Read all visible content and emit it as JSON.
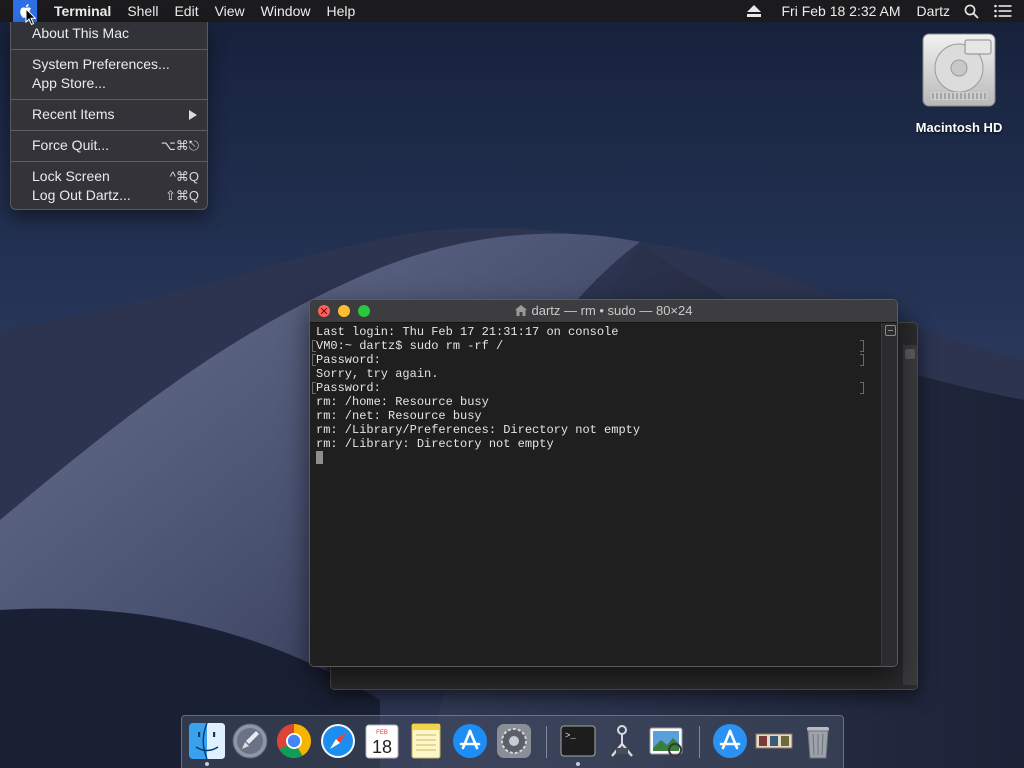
{
  "menubar": {
    "app_name": "Terminal",
    "items": [
      "Shell",
      "Edit",
      "View",
      "Window",
      "Help"
    ],
    "clock": "Fri Feb 18  2:32 AM",
    "user": "Dartz"
  },
  "apple_menu": {
    "items": [
      {
        "label": "About This Mac",
        "shortcut": ""
      },
      {
        "label": "System Preferences...",
        "shortcut": ""
      },
      {
        "label": "App Store...",
        "shortcut": ""
      },
      {
        "label": "Recent Items",
        "shortcut": ""
      },
      {
        "label": "Force Quit...",
        "shortcut": "⌥⌘⎋"
      },
      {
        "label": "Lock Screen",
        "shortcut": "^⌘Q"
      },
      {
        "label": "Log Out Dartz...",
        "shortcut": "⇧⌘Q"
      }
    ]
  },
  "desktop": {
    "drive_label": "Macintosh HD"
  },
  "terminal": {
    "title": "dartz — rm • sudo — 80×24",
    "lines": [
      "Last login: Thu Feb 17 21:31:17 on console",
      "VM0:~ dartz$ sudo rm -rf /",
      "Password:",
      "Sorry, try again.",
      "Password:",
      "rm: /home: Resource busy",
      "rm: /net: Resource busy",
      "rm: /Library/Preferences: Directory not empty",
      "rm: /Library: Directory not empty"
    ]
  },
  "dock": {
    "calendar": {
      "month": "FEB",
      "day": "18"
    },
    "apps": [
      "finder-icon",
      "launchpad-icon",
      "chrome-icon",
      "safari-icon",
      "calendar-icon",
      "notes-icon",
      "app-store-icon",
      "system-preferences-icon",
      "terminal-icon",
      "network-utility-icon",
      "preview-icon",
      "app-store-download-icon",
      "photo-strip-icon",
      "trash-icon"
    ]
  },
  "colors": {
    "menu_highlight": "#2f6fe6",
    "terminal_bg": "#1f1f1f",
    "close_button": "#ff5f57",
    "minimize_button": "#febc2e",
    "zoom_button": "#28c840"
  }
}
